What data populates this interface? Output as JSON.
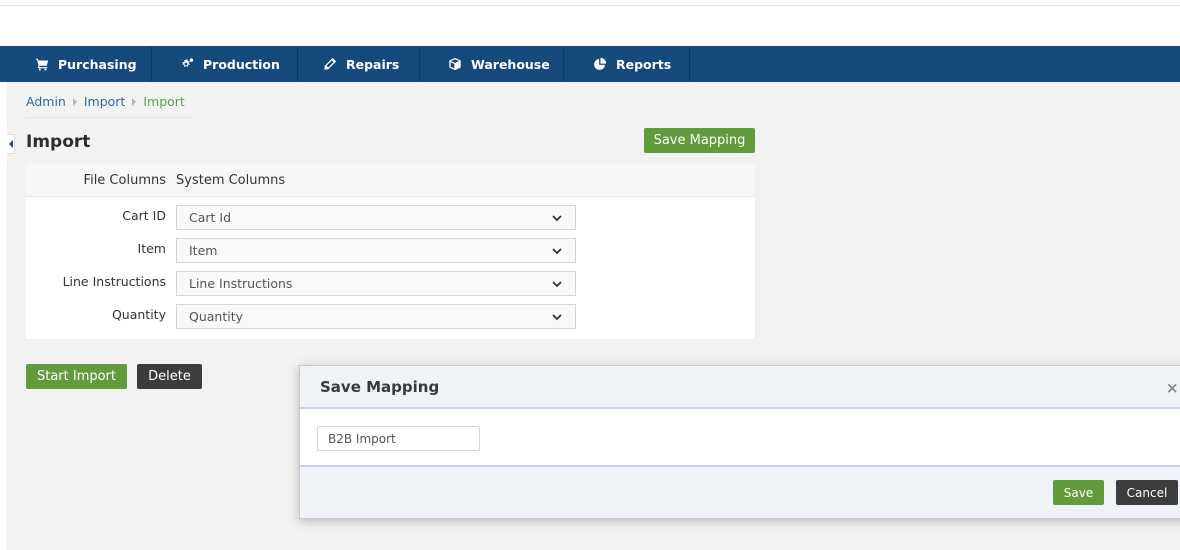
{
  "nav": {
    "items": [
      {
        "label": "Purchasing",
        "icon": "cart-icon"
      },
      {
        "label": "Production",
        "icon": "gears-icon"
      },
      {
        "label": "Repairs",
        "icon": "wrench-icon"
      },
      {
        "label": "Warehouse",
        "icon": "box-icon"
      },
      {
        "label": "Reports",
        "icon": "pie-chart-icon"
      }
    ]
  },
  "breadcrumb": {
    "items": [
      "Admin",
      "Import",
      "Import"
    ]
  },
  "page": {
    "title": "Import",
    "save_mapping_label": "Save Mapping"
  },
  "mapping": {
    "headers": {
      "file": "File Columns",
      "system": "System Columns"
    },
    "rows": [
      {
        "file_column": "Cart ID",
        "system_column": "Cart Id"
      },
      {
        "file_column": "Item",
        "system_column": "Item"
      },
      {
        "file_column": "Line Instructions",
        "system_column": "Line Instructions"
      },
      {
        "file_column": "Quantity",
        "system_column": "Quantity"
      }
    ]
  },
  "actions": {
    "start_import_label": "Start Import",
    "delete_label": "Delete"
  },
  "modal": {
    "title": "Save Mapping",
    "close_glyph": "×",
    "input_value": "B2B Import",
    "save_label": "Save",
    "cancel_label": "Cancel"
  },
  "colors": {
    "nav_bg": "#174a7c",
    "success": "#629b3b",
    "dark_button": "#3c3c3c",
    "link": "#2e6a9e",
    "breadcrumb_active": "#629b58"
  }
}
